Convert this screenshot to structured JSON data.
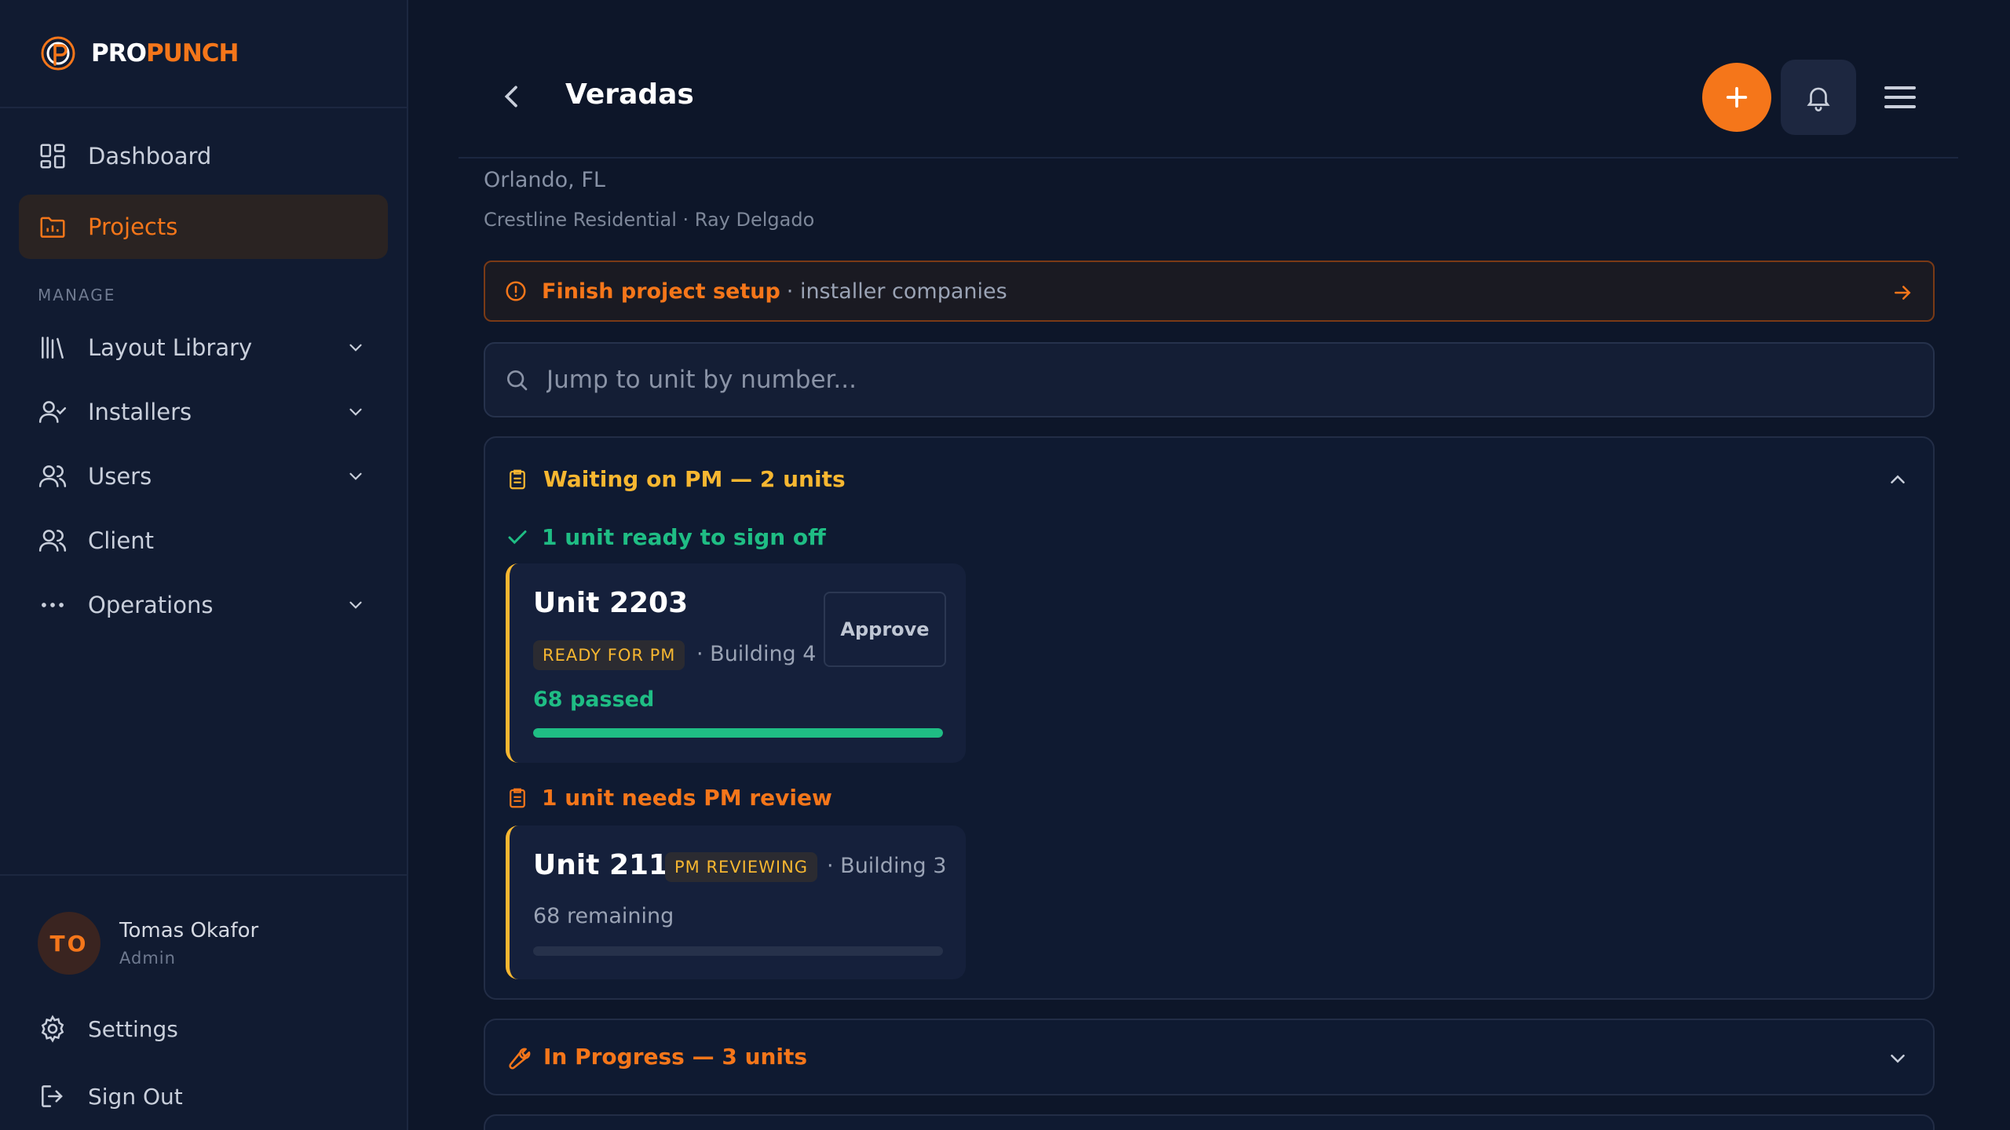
{
  "brand": {
    "pro": "PRO",
    "punch": "PUNCH"
  },
  "colors": {
    "accent": "#f5761a",
    "warning": "#f7b731",
    "success": "#1fbd84",
    "bg": "#0d1629"
  },
  "sidebar": {
    "items": [
      {
        "label": "Dashboard",
        "icon": "dashboard-grid-icon"
      },
      {
        "label": "Projects",
        "icon": "folder-chart-icon",
        "active": true
      }
    ],
    "section_label": "MANAGE",
    "manage_items": [
      {
        "label": "Layout Library",
        "icon": "library-icon"
      },
      {
        "label": "Installers",
        "icon": "user-check-icon"
      },
      {
        "label": "Users",
        "icon": "users-icon"
      },
      {
        "label": "Client",
        "icon": "client-icon"
      },
      {
        "label": "Operations",
        "icon": "more-dots-icon"
      }
    ],
    "user": {
      "initials": "TO",
      "name": "Tomas Okafor",
      "role": "Admin"
    },
    "settings_label": "Settings",
    "signout_label": "Sign Out"
  },
  "header": {
    "title": "Veradas"
  },
  "project": {
    "location": "Orlando, FL",
    "meta": "Crestline Residential · Ray Delgado"
  },
  "setup_banner": {
    "strong": "Finish project setup",
    "rest": "· installer companies"
  },
  "search": {
    "placeholder": "Jump to unit by number..."
  },
  "groups": [
    {
      "title": "Waiting on PM — 2 units",
      "ready_head": "1 unit ready to sign off",
      "review_head": "1 unit needs PM review",
      "units": [
        {
          "name": "Unit 2203",
          "badge": "READY FOR PM",
          "building": "· Building 4",
          "count": "68 passed",
          "progress": 1.0,
          "action": "Approve"
        },
        {
          "name": "Unit 2112",
          "badge": "PM REVIEWING",
          "building": "· Building 3",
          "count": "68 remaining",
          "progress": 0.0
        }
      ]
    },
    {
      "title": "In Progress — 3 units"
    }
  ]
}
